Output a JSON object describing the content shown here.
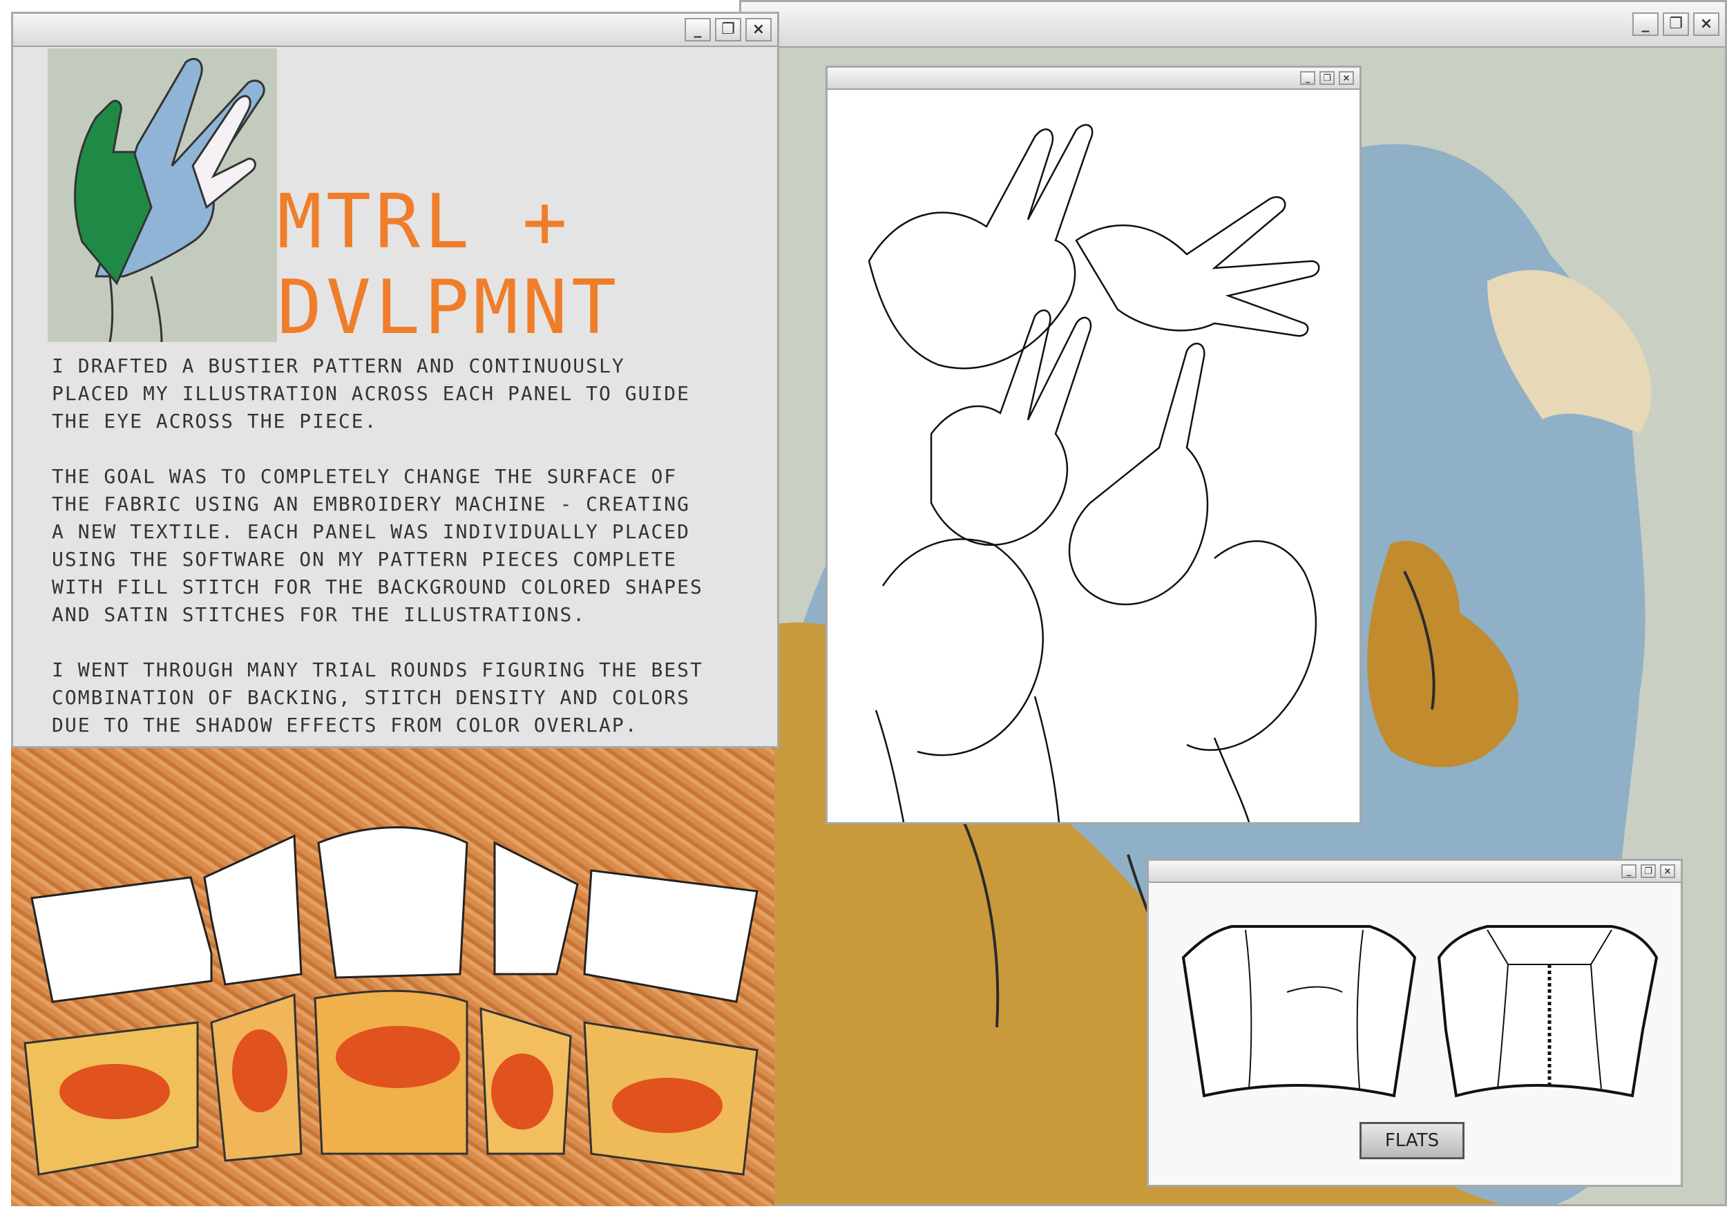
{
  "window_controls": {
    "minimize": "_",
    "restore": "❐",
    "close": "×"
  },
  "info_window": {
    "title_line1": "MTRL +",
    "title_line2": "DVLPMNT",
    "paragraphs": [
      "I DRAFTED A BUSTIER PATTERN AND CONTINUOUSLY\nPLACED MY ILLUSTRATION ACROSS EACH PANEL TO GUIDE\nTHE EYE ACROSS THE PIECE.",
      "THE GOAL WAS TO COMPLETELY CHANGE THE SURFACE OF\nTHE FABRIC USING AN EMBROIDERY MACHINE - CREATING\nA NEW TEXTILE. EACH PANEL WAS INDIVIDUALLY PLACED\nUSING THE SOFTWARE ON MY PATTERN PIECES COMPLETE\nWITH FILL STITCH FOR THE BACKGROUND COLORED SHAPES\nAND SATIN STITCHES FOR THE ILLUSTRATIONS.",
      "I WENT THROUGH MANY TRIAL ROUNDS FIGURING THE BEST\nCOMBINATION OF BACKING, STITCH DENSITY AND COLORS\nDUE TO THE SHADOW EFFECTS FROM COLOR OVERLAP."
    ]
  },
  "flats_window": {
    "button_label": "FLATS"
  },
  "colors": {
    "title_orange": "#f07d2a",
    "window_gray": "#e4e4e4",
    "sage_background": "#c9cfc3",
    "embroidery_blue": "#8fb0c6",
    "embroidery_gold": "#c99a3c",
    "embroidery_green": "#1f8a45"
  }
}
